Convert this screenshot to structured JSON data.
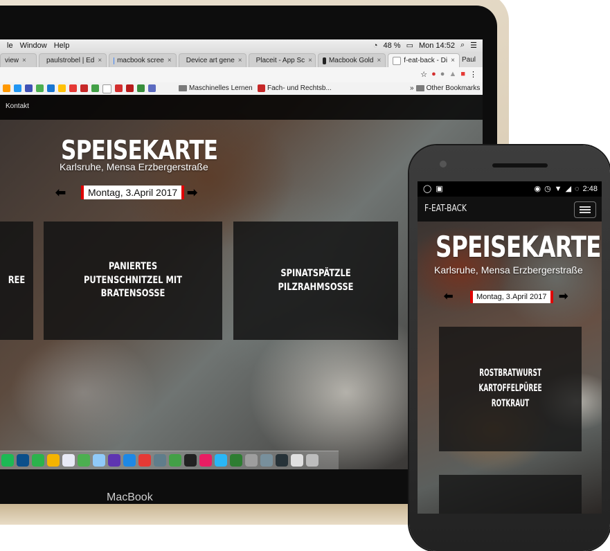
{
  "laptop": {
    "brand_label": "MacBook",
    "menubar": {
      "items": [
        "le",
        "Window",
        "Help"
      ],
      "battery": "48 %",
      "clock": "Mon 14:52"
    },
    "tabs": [
      {
        "label": "view",
        "color": "#9e9e9e"
      },
      {
        "label": "paulstrobel | Ed",
        "color": "#3b7bbf"
      },
      {
        "label": "macbook scree",
        "color": "#4285f4"
      },
      {
        "label": "Device art gene",
        "color": "#7cb342"
      },
      {
        "label": "Placeit - App Sc",
        "color": "#1e88e5"
      },
      {
        "label": "Macbook Gold",
        "color": "#222222"
      },
      {
        "label": "f-eat-back - Di",
        "color": "#ffffff"
      }
    ],
    "profile_name": "Paul",
    "bookmarks": {
      "folder_1": "Maschinelles Lernen",
      "folder_2": "Fach- und Rechtsb...",
      "other": "Other Bookmarks",
      "overflow": "»"
    },
    "site": {
      "nav_link": "Kontakt",
      "title": "SPEISEKARTE",
      "subtitle": "Karlsruhe, Mensa Erzbergerstraße",
      "date": "Montag, 3.April 2017",
      "cards": [
        {
          "text": "REE"
        },
        {
          "text": "PANIERTES PUTENSCHNITZEL MIT BRATENSOSSE"
        },
        {
          "text": "SPINATSPÄTZLE PILZRAHMSOSSE"
        }
      ]
    }
  },
  "phone": {
    "status_time": "2:48",
    "brand": "F-EAT-BACK",
    "site": {
      "title": "SPEISEKARTE",
      "subtitle": "Karlsruhe, Mensa Erzbergerstraße",
      "date": "Montag, 3.April 2017",
      "card_line1": "ROSTBRATWURST",
      "card_line2": "KARTOFFELPÜREE ROTKRAUT"
    }
  },
  "colors": {
    "accent_red": "#e00000",
    "overlay": "#141414",
    "laptop_gold": "#d9cbb3"
  }
}
